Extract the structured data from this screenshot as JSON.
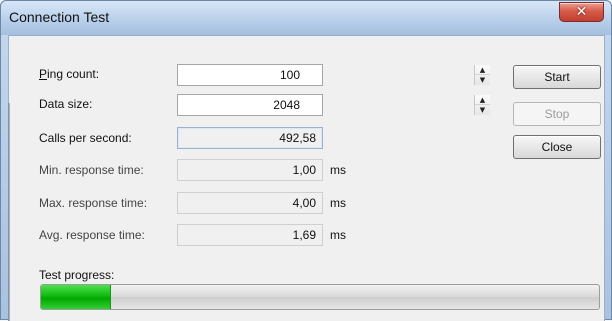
{
  "window": {
    "title": "Connection Test"
  },
  "fields": {
    "ping_count": {
      "label_accel": "P",
      "label_rest": "ing count:",
      "value": "100"
    },
    "data_size": {
      "label": "Data size:",
      "value": "2048"
    },
    "calls_per_second": {
      "label": "Calls per second:",
      "value": "492,58"
    },
    "min_response_time": {
      "label": "Min. response time:",
      "value": "1,00",
      "unit": "ms"
    },
    "max_response_time": {
      "label": "Max. response time:",
      "value": "4,00",
      "unit": "ms"
    },
    "avg_response_time": {
      "label": "Avg. response time:",
      "value": "1,69",
      "unit": "ms"
    }
  },
  "buttons": {
    "start": "Start",
    "stop": "Stop",
    "close": "Close"
  },
  "progress": {
    "label": "Test progress:",
    "fraction": 0.125
  },
  "icons": {
    "close": "close-icon",
    "spinner_up": "chevron-up-icon",
    "spinner_down": "chevron-down-icon"
  },
  "colors": {
    "progress_green": "#11b911",
    "titlebar_blue": "#b9d0ea"
  }
}
